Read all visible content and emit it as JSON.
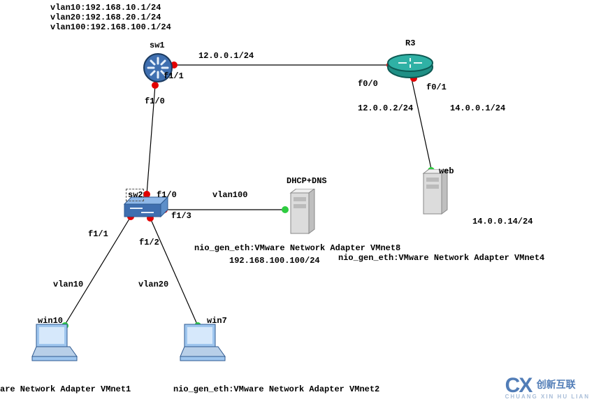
{
  "header": {
    "vlan10": "vlan10:192.168.10.1/24",
    "vlan20": "vlan20:192.168.20.1/24",
    "vlan100": "vlan100:192.168.100.1/24"
  },
  "nodes": {
    "sw1": {
      "label": "sw1"
    },
    "sw2": {
      "label": "sw2"
    },
    "r3": {
      "label": "R3"
    },
    "dhcp": {
      "label": "DHCP+DNS"
    },
    "web": {
      "label": "web"
    },
    "win10": {
      "label": "win10"
    },
    "win7": {
      "label": "win7"
    }
  },
  "ports": {
    "sw1_f11": "f1/1",
    "sw1_f10": "f1/0",
    "sw2_f10": "f1/0",
    "sw2_f11": "f1/1",
    "sw2_f12": "f1/2",
    "sw2_f13": "f1/3",
    "r3_f00": "f0/0",
    "r3_f01": "f0/1"
  },
  "nets": {
    "net12_1": "12.0.0.1/24",
    "net12_2": "12.0.0.2/24",
    "net14_1": "14.0.0.1/24",
    "net14_14": "14.0.0.14/24",
    "vlan100": "vlan100",
    "vlan10": "vlan10",
    "vlan20": "vlan20",
    "dhcp_ip": "192.168.100.100/24"
  },
  "nio": {
    "vmnet8": "nio_gen_eth:VMware Network Adapter VMnet8",
    "vmnet4": "nio_gen_eth:VMware Network Adapter VMnet4",
    "vmnet1_short": "are Network Adapter VMnet1",
    "vmnet2": "nio_gen_eth:VMware Network Adapter VMnet2"
  },
  "watermark": {
    "logo": "CX",
    "cn": "创新互联",
    "py": "CHUANG XIN HU LIAN"
  }
}
